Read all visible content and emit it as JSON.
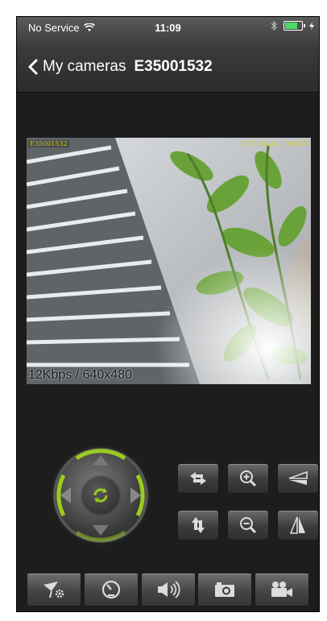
{
  "status_bar": {
    "carrier": "No Service",
    "time": "11:09"
  },
  "nav": {
    "back_label": "My cameras",
    "title": "E35001532"
  },
  "video": {
    "osd_camera_id": "E35001532",
    "osd_timestamp": "2015-04-24 11:09:21",
    "bitrate_text": "12Kbps / 640x480"
  },
  "colors": {
    "accent_green": "#9acd1f",
    "icon_gray": "#dcdcdc"
  },
  "icons": {
    "ptz_center": "refresh-icon",
    "row1": [
      "horizontal-flip-arrows-icon",
      "zoom-in-icon",
      "flip-vertical-icon"
    ],
    "row2": [
      "vertical-flip-arrows-icon",
      "zoom-out-icon",
      "mirror-icon"
    ],
    "toolbar": [
      "settings-icon",
      "speed-gauge-icon",
      "speaker-icon",
      "camera-icon",
      "video-record-icon"
    ]
  }
}
